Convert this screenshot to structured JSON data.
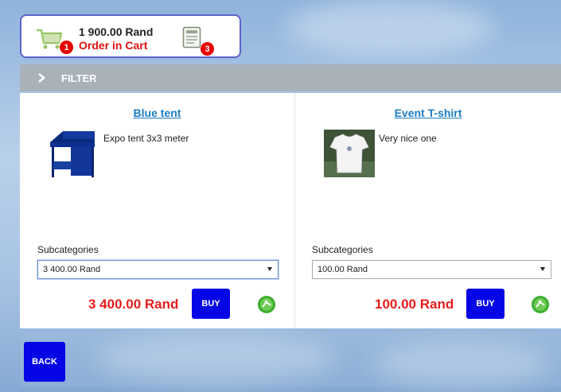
{
  "cart": {
    "total": "1 900.00 Rand",
    "status": "Order in Cart",
    "item_badge": "1",
    "orders_badge": "3"
  },
  "filter": {
    "label": "FILTER"
  },
  "products": [
    {
      "title": "Blue tent",
      "description": "Expo tent 3x3 meter",
      "subcategories_label": "Subcategories",
      "selected_option": "3 400.00 Rand",
      "price": "3 400.00 Rand",
      "buy_label": "BUY",
      "image_icon": "blue-tent-image"
    },
    {
      "title": "Event T-shirt",
      "description": "Very nice one",
      "subcategories_label": "Subcategories",
      "selected_option": "100.00 Rand",
      "price": "100.00 Rand",
      "buy_label": "BUY",
      "image_icon": "white-tshirt-image"
    }
  ],
  "back_label": "BACK",
  "colors": {
    "accent_blue": "#0505e6",
    "price_red": "#e61c1c",
    "link_blue": "#1c7cc2",
    "filter_gray": "#a9b1b9",
    "badge_red": "#e60000"
  }
}
